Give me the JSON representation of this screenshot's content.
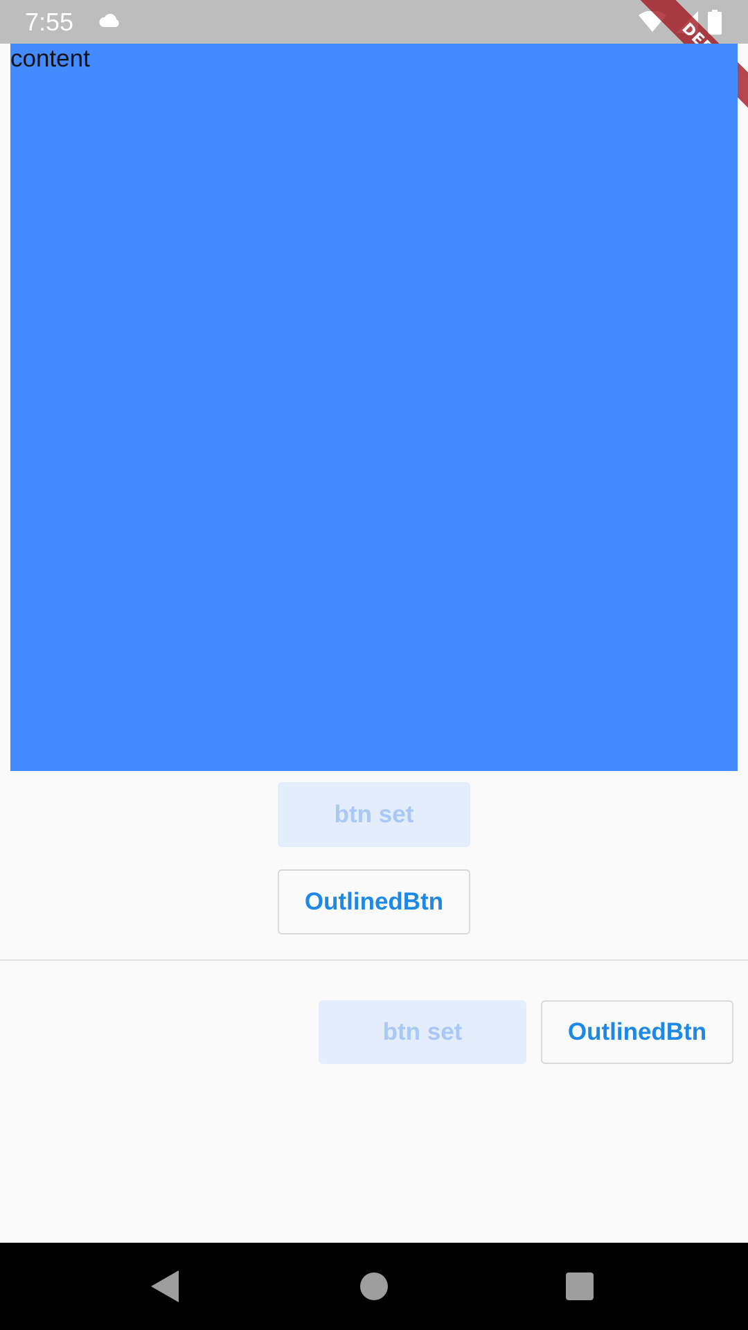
{
  "status_bar": {
    "time": "7:55",
    "icons": [
      "cloud-icon",
      "wifi-icon",
      "cell-signal-icon",
      "battery-icon"
    ],
    "background_color": "#bdbdbd"
  },
  "debug_banner": {
    "label": "DEBUG"
  },
  "content": {
    "label": "content",
    "background_color": "#448aff"
  },
  "vertical_buttons": {
    "set_label": "btn set",
    "outlined_label": "OutlinedBtn"
  },
  "horizontal_buttons": {
    "set_label": "btn set",
    "outlined_label": "OutlinedBtn"
  },
  "colors": {
    "accent": "#1e88e5",
    "disabled_text": "#a9c8f5",
    "disabled_bg": "#e3edfc"
  },
  "nav_bar": {
    "icons": [
      "back-icon",
      "home-icon",
      "recents-icon"
    ]
  }
}
